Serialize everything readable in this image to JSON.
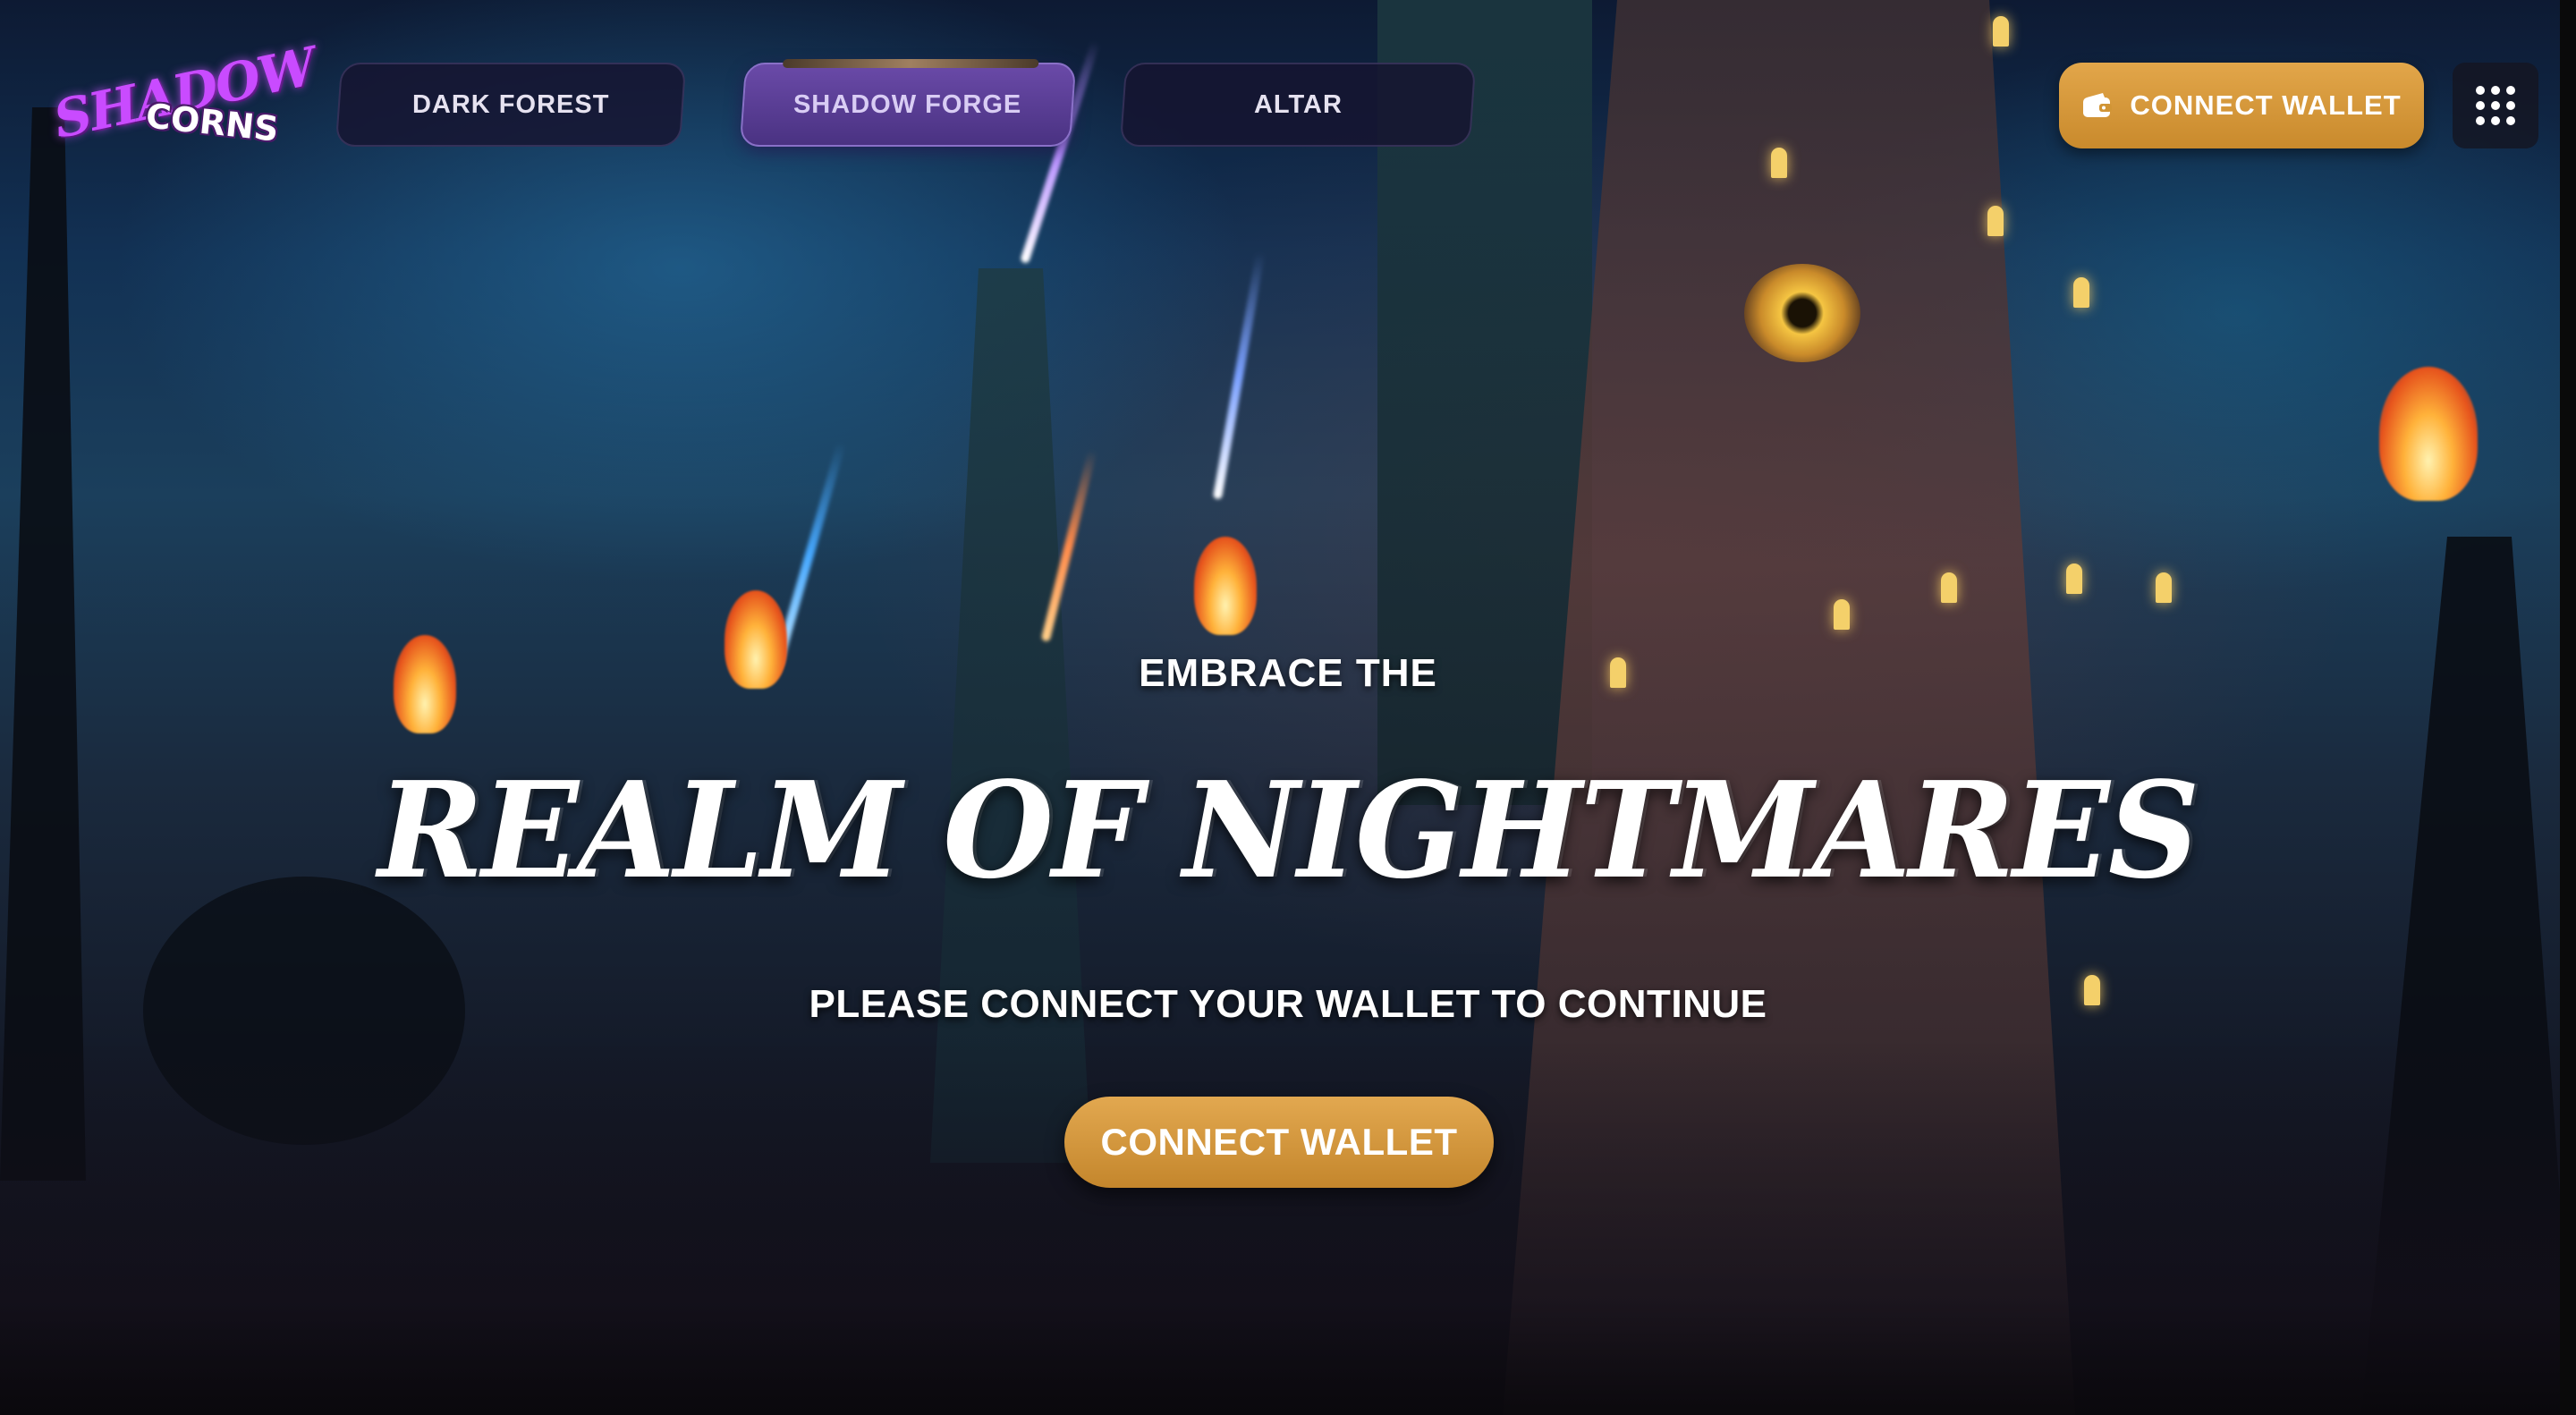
{
  "logo": {
    "line1": "SHADOW",
    "line2": "CORNS"
  },
  "nav": {
    "tabs": [
      {
        "label": "DARK FOREST",
        "active": false
      },
      {
        "label": "SHADOW FORGE",
        "active": true
      },
      {
        "label": "ALTAR",
        "active": false
      }
    ]
  },
  "header": {
    "wallet_button": {
      "label": "CONNECT WALLET",
      "icon": "wallet-icon"
    },
    "menu_icon": "grid-menu-icon"
  },
  "hero": {
    "kicker": "EMBRACE THE",
    "title": "REALM OF NIGHTMARES",
    "subtitle": "PLEASE CONNECT YOUR WALLET TO CONTINUE",
    "button_label": "CONNECT WALLET"
  },
  "colors": {
    "accent_gold": "#d39a3c",
    "active_tab": "#5a3e96",
    "logo_purple": "#c94bff"
  }
}
